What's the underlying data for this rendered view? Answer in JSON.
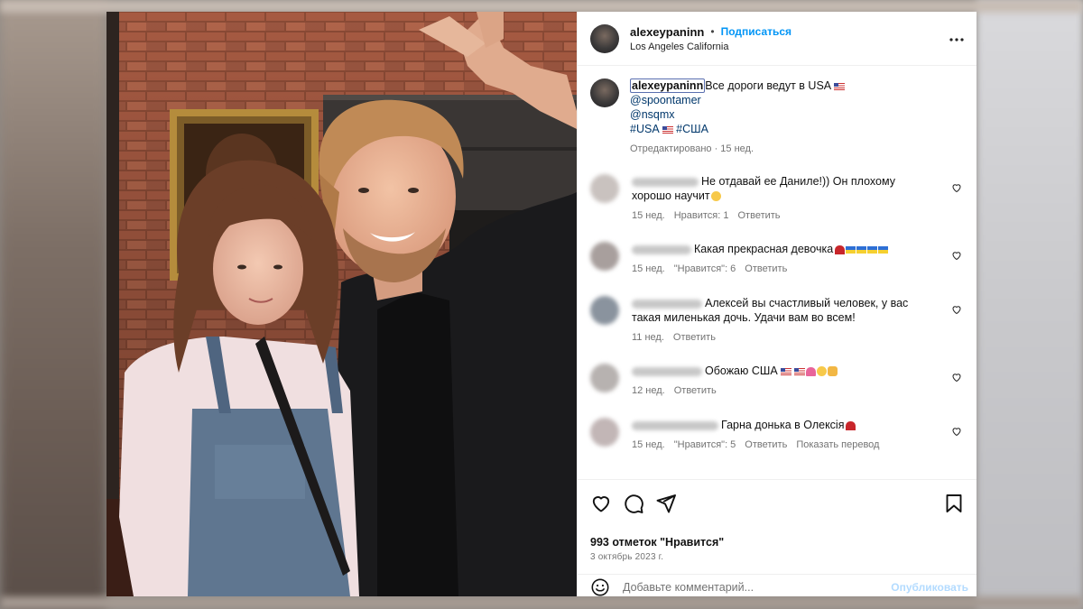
{
  "header": {
    "username": "alexeypaninn",
    "separator": "•",
    "follow_label": "Подписаться",
    "location": "Los Angeles California",
    "more_icon": "more-horizontal-icon"
  },
  "caption": {
    "username": "alexeypaninn",
    "text": "Все дороги ведут в USA",
    "mention1": "@spoontamer",
    "mention2": "@nsqmx",
    "hashtag1": "#USA",
    "hashtag2": "#США",
    "edited": "Отредактировано · 15 нед."
  },
  "comments": [
    {
      "text_line1": "Не отдавай ее Даниле!)) Он плохому",
      "text_line2": "хорошо научит",
      "time": "15 нед.",
      "likes": "Нравится: 1",
      "reply": "Ответить"
    },
    {
      "text": "Какая прекрасная девочка",
      "time": "15 нед.",
      "likes": "\"Нравится\": 6",
      "reply": "Ответить"
    },
    {
      "text_line1": "Алексей вы счастливый человек, у вас",
      "text_line2": "такая миленькая дочь. Удачи вам во всем!",
      "time": "11 нед.",
      "reply": "Ответить"
    },
    {
      "text": "Обожаю США",
      "time": "12 нед.",
      "reply": "Ответить"
    },
    {
      "text": "Гарна донька в Олексія",
      "time": "15 нед.",
      "likes": "\"Нравится\": 5",
      "reply": "Ответить",
      "translate": "Показать перевод"
    }
  ],
  "actions": {
    "like_icon": "heart-icon",
    "comment_icon": "comment-icon",
    "share_icon": "send-icon",
    "save_icon": "bookmark-icon",
    "likes_count": "993 отметок \"Нравится\"",
    "date": "3 октябрь 2023 г."
  },
  "add_comment": {
    "emoji_icon": "emoji-icon",
    "placeholder": "Добавьте комментарий...",
    "publish_label": "Опубликовать"
  },
  "colors": {
    "link_blue": "#0095f6",
    "mention_blue": "#00376b",
    "muted_gray": "#737373",
    "publish_disabled": "#b3dbff"
  }
}
